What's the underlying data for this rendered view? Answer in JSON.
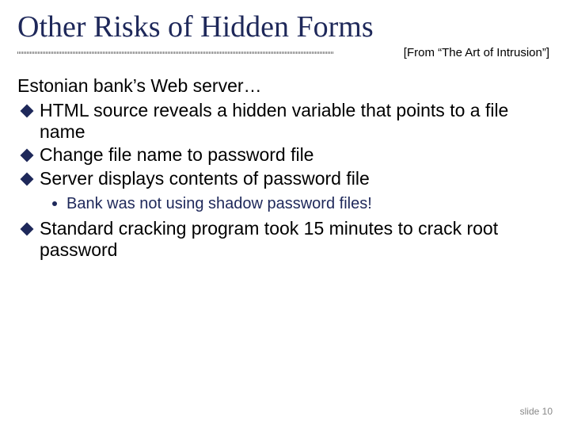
{
  "title": "Other Risks of Hidden Forms",
  "source": "[From “The Art of Intrusion”]",
  "body": {
    "intro": "Estonian bank’s Web server…",
    "b1": "HTML source reveals a hidden variable that points to a file name",
    "b2": "Change file name to password file",
    "b3": "Server displays contents of password file",
    "b3_sub": "Bank was not using shadow password files!",
    "b4": "Standard cracking program took 15 minutes to crack root password"
  },
  "footer": "slide 10"
}
